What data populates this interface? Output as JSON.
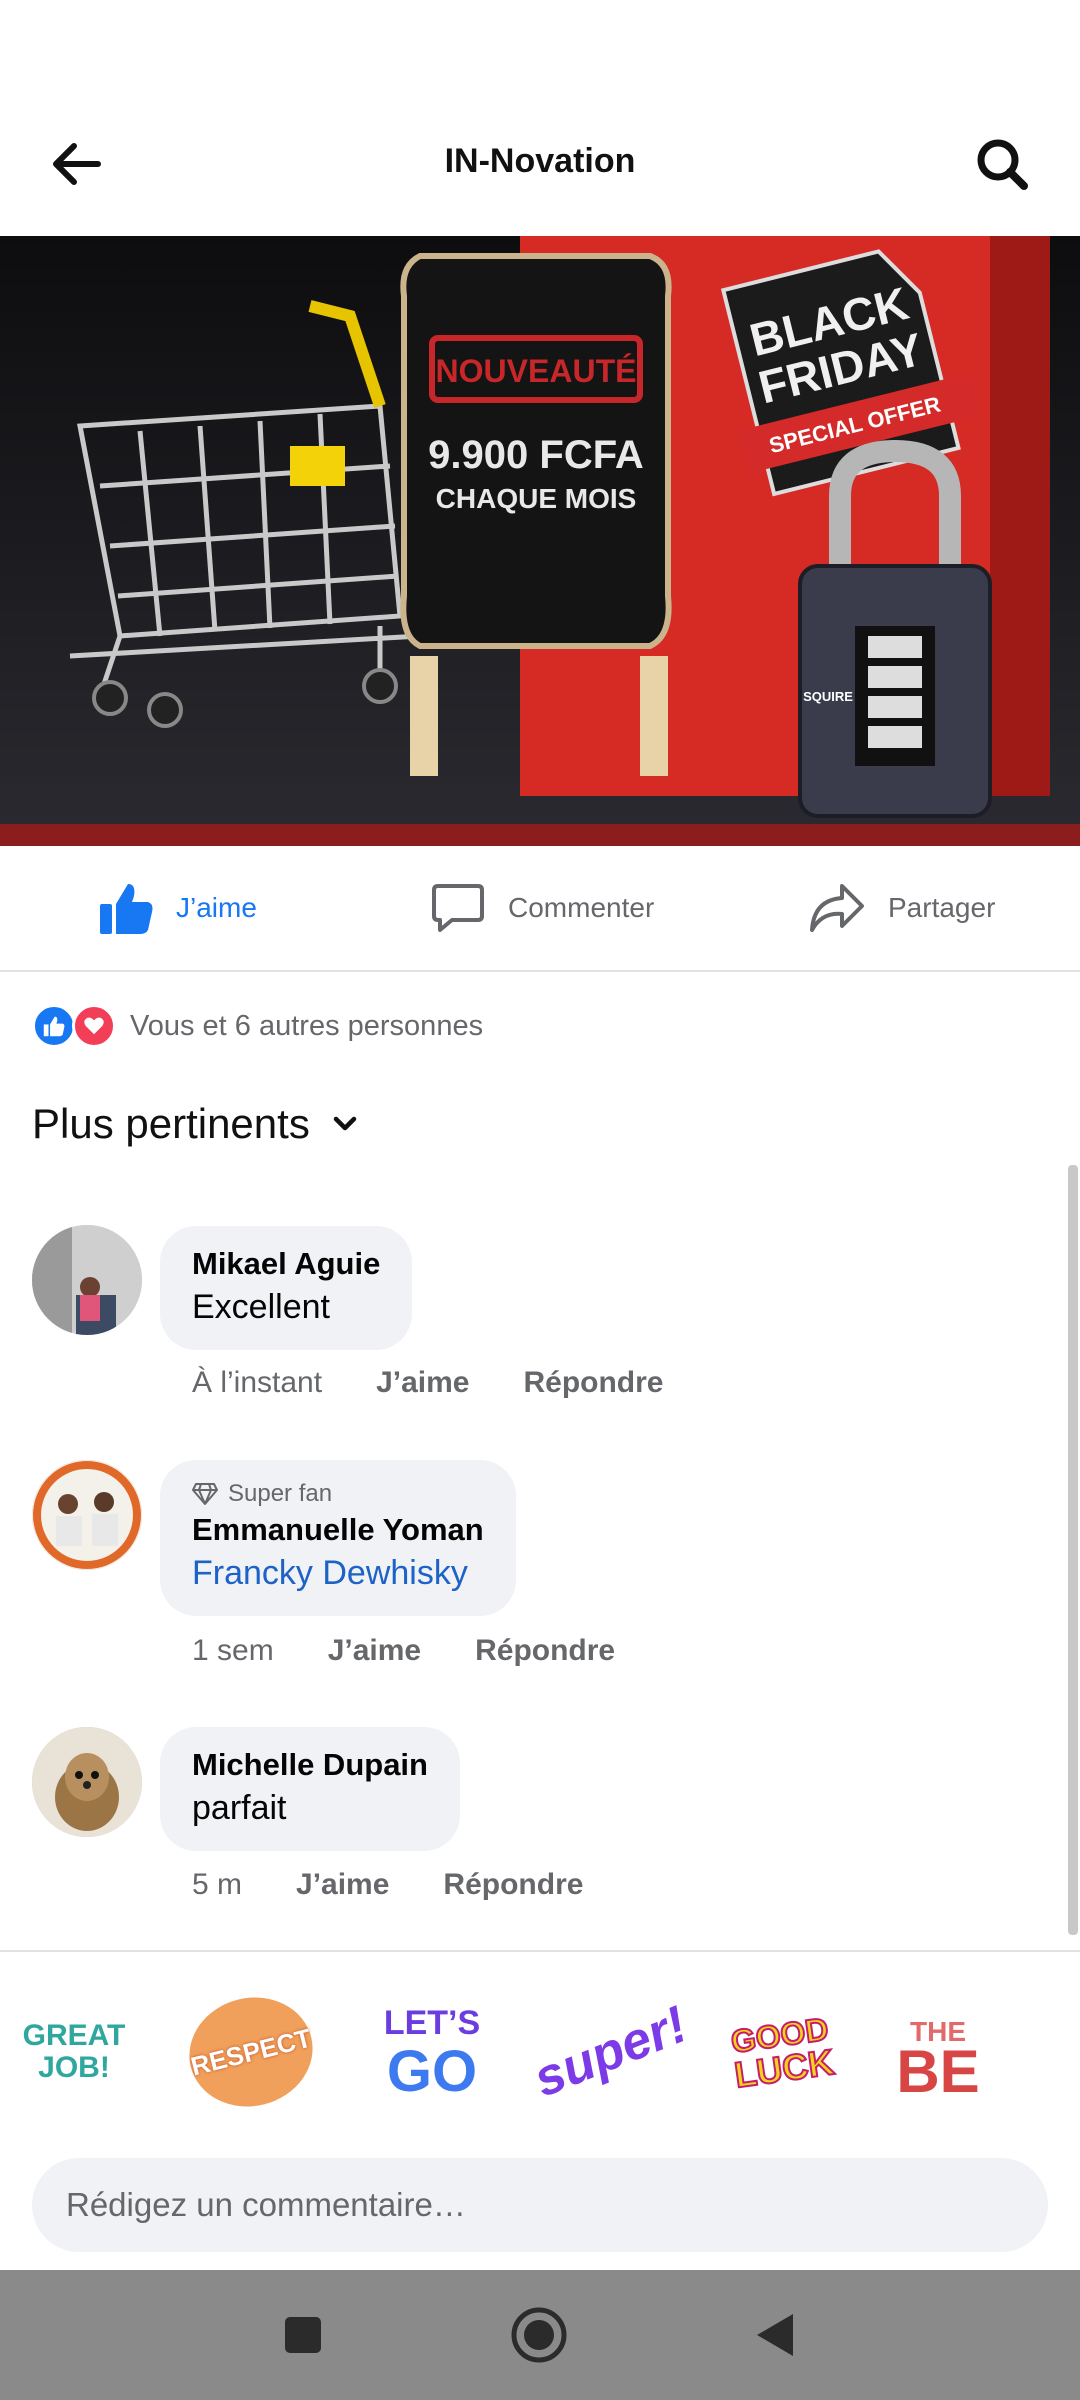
{
  "header": {
    "title": "IN-Novation",
    "back_icon": "arrow-left-icon",
    "search_icon": "search-icon"
  },
  "post_image": {
    "badge": "NOUVEAUTÉ",
    "price": "9.900 FCFA",
    "period": "CHAQUE MOIS",
    "tag_line1": "BLACK",
    "tag_line2": "FRIDAY",
    "tag_ribbon": "SPECIAL OFFER",
    "lock_brand": "SQUIRE"
  },
  "actions": {
    "like": "J’aime",
    "comment": "Commenter",
    "share": "Partager"
  },
  "reactions": {
    "text": "Vous et 6 autres personnes"
  },
  "sort": {
    "label": "Plus pertinents"
  },
  "comments": [
    {
      "name": "Mikael Aguie",
      "text": "Excellent",
      "time": "À l’instant",
      "like": "J’aime",
      "reply": "Répondre"
    },
    {
      "badge": "Super fan",
      "name": "Emmanuelle Yoman",
      "text": "Francky Dewhisky",
      "time": "1 sem",
      "like": "J’aime",
      "reply": "Répondre"
    },
    {
      "name": "Michelle Dupain",
      "text": "parfait",
      "time": "5 m",
      "like": "J’aime",
      "reply": "Répondre"
    }
  ],
  "stickers": [
    {
      "line1": "GREAT",
      "line2": "JOB!"
    },
    {
      "line1": "RESPECT"
    },
    {
      "line1": "LET’S",
      "line2": "GO"
    },
    {
      "line1": "super!"
    },
    {
      "line1": "GOOD",
      "line2": "LUCK"
    },
    {
      "line1": "THE",
      "line2": "BE"
    }
  ],
  "input": {
    "placeholder": "Rédigez un commentaire…",
    "value": ""
  },
  "colors": {
    "accent": "#1877f2",
    "love": "#f33e58",
    "link": "#1c62c7"
  }
}
